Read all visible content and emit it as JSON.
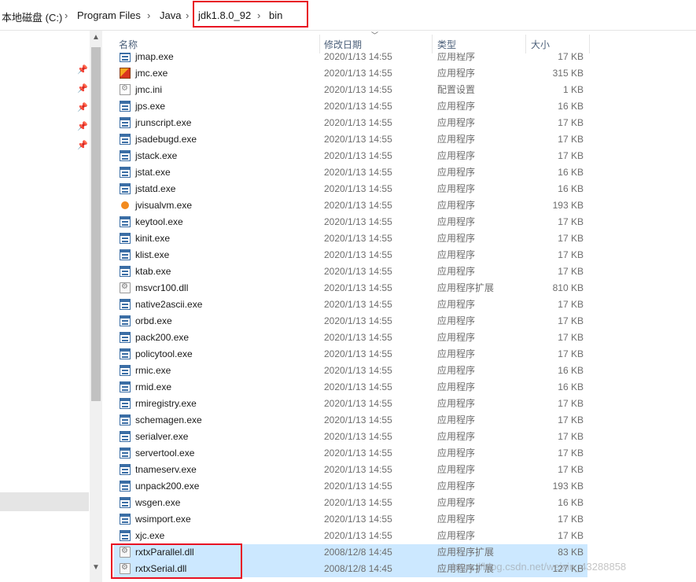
{
  "breadcrumb": {
    "items": [
      "本地磁盘 (C:)",
      "Program Files",
      "Java",
      "jdk1.8.0_92",
      "bin"
    ],
    "separator": "›"
  },
  "columns": {
    "name": "名称",
    "date": "修改日期",
    "type": "类型",
    "size": "大小"
  },
  "files": [
    {
      "name": "jmap.exe",
      "date": "2020/1/13 14:55",
      "type": "应用程序",
      "size": "17 KB",
      "icon": "exe-icon"
    },
    {
      "name": "jmc.exe",
      "date": "2020/1/13 14:55",
      "type": "应用程序",
      "size": "315 KB",
      "icon": "jmc-icon"
    },
    {
      "name": "jmc.ini",
      "date": "2020/1/13 14:55",
      "type": "配置设置",
      "size": "1 KB",
      "icon": "ini-icon"
    },
    {
      "name": "jps.exe",
      "date": "2020/1/13 14:55",
      "type": "应用程序",
      "size": "16 KB",
      "icon": "exe-icon"
    },
    {
      "name": "jrunscript.exe",
      "date": "2020/1/13 14:55",
      "type": "应用程序",
      "size": "17 KB",
      "icon": "exe-icon"
    },
    {
      "name": "jsadebugd.exe",
      "date": "2020/1/13 14:55",
      "type": "应用程序",
      "size": "17 KB",
      "icon": "exe-icon"
    },
    {
      "name": "jstack.exe",
      "date": "2020/1/13 14:55",
      "type": "应用程序",
      "size": "17 KB",
      "icon": "exe-icon"
    },
    {
      "name": "jstat.exe",
      "date": "2020/1/13 14:55",
      "type": "应用程序",
      "size": "16 KB",
      "icon": "exe-icon"
    },
    {
      "name": "jstatd.exe",
      "date": "2020/1/13 14:55",
      "type": "应用程序",
      "size": "16 KB",
      "icon": "exe-icon"
    },
    {
      "name": "jvisualvm.exe",
      "date": "2020/1/13 14:55",
      "type": "应用程序",
      "size": "193 KB",
      "icon": "jvisualvm-icon"
    },
    {
      "name": "keytool.exe",
      "date": "2020/1/13 14:55",
      "type": "应用程序",
      "size": "17 KB",
      "icon": "exe-icon"
    },
    {
      "name": "kinit.exe",
      "date": "2020/1/13 14:55",
      "type": "应用程序",
      "size": "17 KB",
      "icon": "exe-icon"
    },
    {
      "name": "klist.exe",
      "date": "2020/1/13 14:55",
      "type": "应用程序",
      "size": "17 KB",
      "icon": "exe-icon"
    },
    {
      "name": "ktab.exe",
      "date": "2020/1/13 14:55",
      "type": "应用程序",
      "size": "17 KB",
      "icon": "exe-icon"
    },
    {
      "name": "msvcr100.dll",
      "date": "2020/1/13 14:55",
      "type": "应用程序扩展",
      "size": "810 KB",
      "icon": "dll-icon"
    },
    {
      "name": "native2ascii.exe",
      "date": "2020/1/13 14:55",
      "type": "应用程序",
      "size": "17 KB",
      "icon": "exe-icon"
    },
    {
      "name": "orbd.exe",
      "date": "2020/1/13 14:55",
      "type": "应用程序",
      "size": "17 KB",
      "icon": "exe-icon"
    },
    {
      "name": "pack200.exe",
      "date": "2020/1/13 14:55",
      "type": "应用程序",
      "size": "17 KB",
      "icon": "exe-icon"
    },
    {
      "name": "policytool.exe",
      "date": "2020/1/13 14:55",
      "type": "应用程序",
      "size": "17 KB",
      "icon": "exe-icon"
    },
    {
      "name": "rmic.exe",
      "date": "2020/1/13 14:55",
      "type": "应用程序",
      "size": "16 KB",
      "icon": "exe-icon"
    },
    {
      "name": "rmid.exe",
      "date": "2020/1/13 14:55",
      "type": "应用程序",
      "size": "16 KB",
      "icon": "exe-icon"
    },
    {
      "name": "rmiregistry.exe",
      "date": "2020/1/13 14:55",
      "type": "应用程序",
      "size": "17 KB",
      "icon": "exe-icon"
    },
    {
      "name": "schemagen.exe",
      "date": "2020/1/13 14:55",
      "type": "应用程序",
      "size": "17 KB",
      "icon": "exe-icon"
    },
    {
      "name": "serialver.exe",
      "date": "2020/1/13 14:55",
      "type": "应用程序",
      "size": "17 KB",
      "icon": "exe-icon"
    },
    {
      "name": "servertool.exe",
      "date": "2020/1/13 14:55",
      "type": "应用程序",
      "size": "17 KB",
      "icon": "exe-icon"
    },
    {
      "name": "tnameserv.exe",
      "date": "2020/1/13 14:55",
      "type": "应用程序",
      "size": "17 KB",
      "icon": "exe-icon"
    },
    {
      "name": "unpack200.exe",
      "date": "2020/1/13 14:55",
      "type": "应用程序",
      "size": "193 KB",
      "icon": "exe-icon"
    },
    {
      "name": "wsgen.exe",
      "date": "2020/1/13 14:55",
      "type": "应用程序",
      "size": "16 KB",
      "icon": "exe-icon"
    },
    {
      "name": "wsimport.exe",
      "date": "2020/1/13 14:55",
      "type": "应用程序",
      "size": "17 KB",
      "icon": "exe-icon"
    },
    {
      "name": "xjc.exe",
      "date": "2020/1/13 14:55",
      "type": "应用程序",
      "size": "17 KB",
      "icon": "exe-icon"
    },
    {
      "name": "rxtxParallel.dll",
      "date": "2008/12/8 14:45",
      "type": "应用程序扩展",
      "size": "83 KB",
      "icon": "dll-icon",
      "selected": true
    },
    {
      "name": "rxtxSerial.dll",
      "date": "2008/12/8 14:45",
      "type": "应用程序扩展",
      "size": "127 KB",
      "icon": "dll-icon",
      "selected": true
    }
  ],
  "watermark": "https://blog.csdn.net/weixin_43288858"
}
